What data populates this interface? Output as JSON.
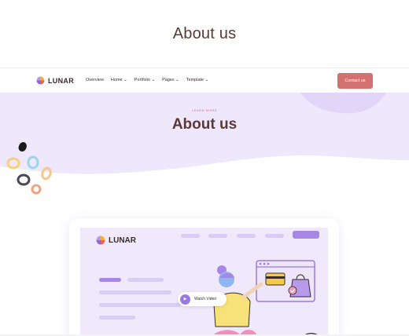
{
  "header": {
    "title": "About us"
  },
  "navbar": {
    "logo_text": "LUNAR",
    "links": [
      "Overview",
      "Home ⌄",
      "Portfolio ⌄",
      "Pages ⌄",
      "Template ⌄"
    ],
    "contact_label": "Contact us"
  },
  "hero": {
    "eyebrow": "LEARN MORE",
    "title": "About us"
  },
  "preview_card": {
    "logo_text": "LUNAR",
    "watch_label": "Watch Video",
    "icons": [
      "play-icon",
      "credit-card-icon",
      "shopping-bag-icon",
      "check-icon"
    ]
  },
  "colors": {
    "hero_bg": "#efe7fb",
    "title": "#5a3a38",
    "accent": "#d27170",
    "purple": "#9b78df"
  }
}
